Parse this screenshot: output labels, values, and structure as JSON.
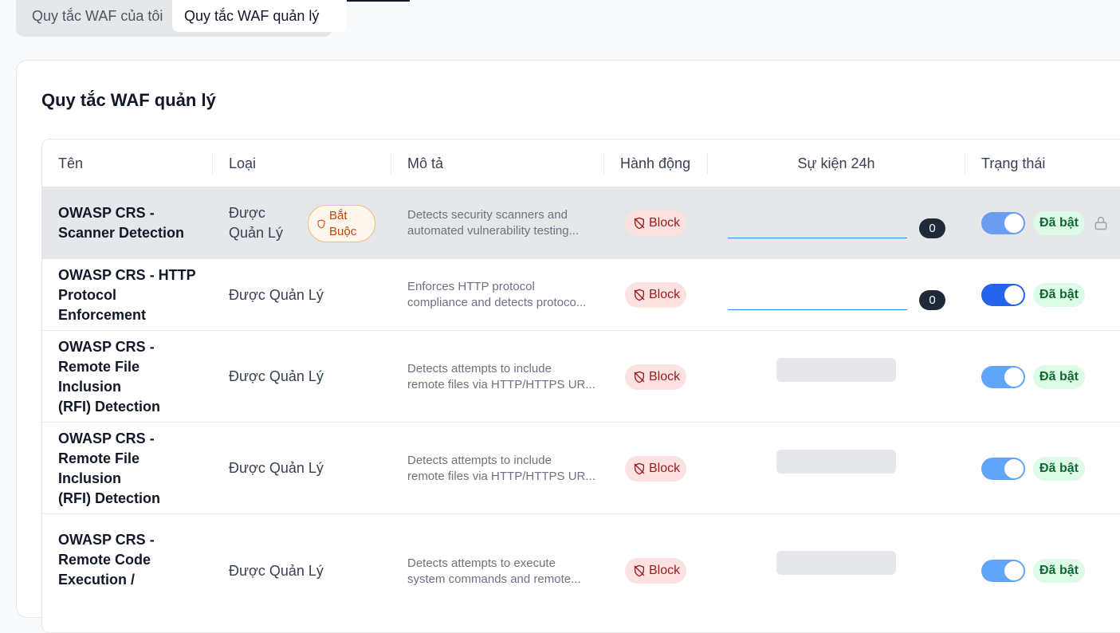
{
  "tabs": {
    "my_rules": "Quy tắc WAF của tôi",
    "managed_rules": "Quy tắc WAF quản lý"
  },
  "card": {
    "title": "Quy tắc WAF quản lý"
  },
  "table": {
    "headers": {
      "name": "Tên",
      "type": "Loại",
      "description": "Mô tả",
      "action": "Hành động",
      "events": "Sự kiện 24h",
      "status": "Trạng thái"
    },
    "rows": [
      {
        "name_l1": "OWASP CRS -",
        "name_l2": "Scanner Detection",
        "type_l1": "Được",
        "type_l2": "Quản Lý",
        "required_l1": "Bắt",
        "required_l2": "Buộc",
        "desc_l1": "Detects security scanners and",
        "desc_l2": "automated vulnerability testing...",
        "action": "Block",
        "events": "0",
        "status": "Đã bật"
      },
      {
        "name_l1": "OWASP CRS - HTTP",
        "name_l2": "Protocol Enforcement",
        "type": "Được Quản Lý",
        "desc_l1": "Enforces HTTP protocol",
        "desc_l2": "compliance and detects protoco...",
        "action": "Block",
        "events": "0",
        "status": "Đã bật"
      },
      {
        "name_l1": "OWASP CRS -",
        "name_l2": "Remote File Inclusion",
        "name_l3": "(RFI) Detection",
        "type": "Được Quản Lý",
        "desc_l1": "Detects attempts to include",
        "desc_l2": "remote files via HTTP/HTTPS UR...",
        "action": "Block",
        "status": "Đã bật"
      },
      {
        "name_l1": "OWASP CRS -",
        "name_l2": "Remote File Inclusion",
        "name_l3": "(RFI) Detection",
        "type": "Được Quản Lý",
        "desc_l1": "Detects attempts to include",
        "desc_l2": "remote files via HTTP/HTTPS UR...",
        "action": "Block",
        "status": "Đã bật"
      },
      {
        "name_l1": "OWASP CRS -",
        "name_l2": "Remote Code",
        "name_l3": "Execution /",
        "type": "Được Quản Lý",
        "desc_l1": "Detects attempts to execute",
        "desc_l2": "system commands and remote...",
        "action": "Block",
        "status": "Đã bật"
      }
    ]
  },
  "colors": {
    "toggle_on": "#2563eb",
    "block_bg": "#fee2e2",
    "status_bg": "#dcfce7",
    "required_border": "#fdba74"
  },
  "icons": {
    "block": "shield-off-icon",
    "required": "shield-icon",
    "locked": "lock-icon"
  }
}
